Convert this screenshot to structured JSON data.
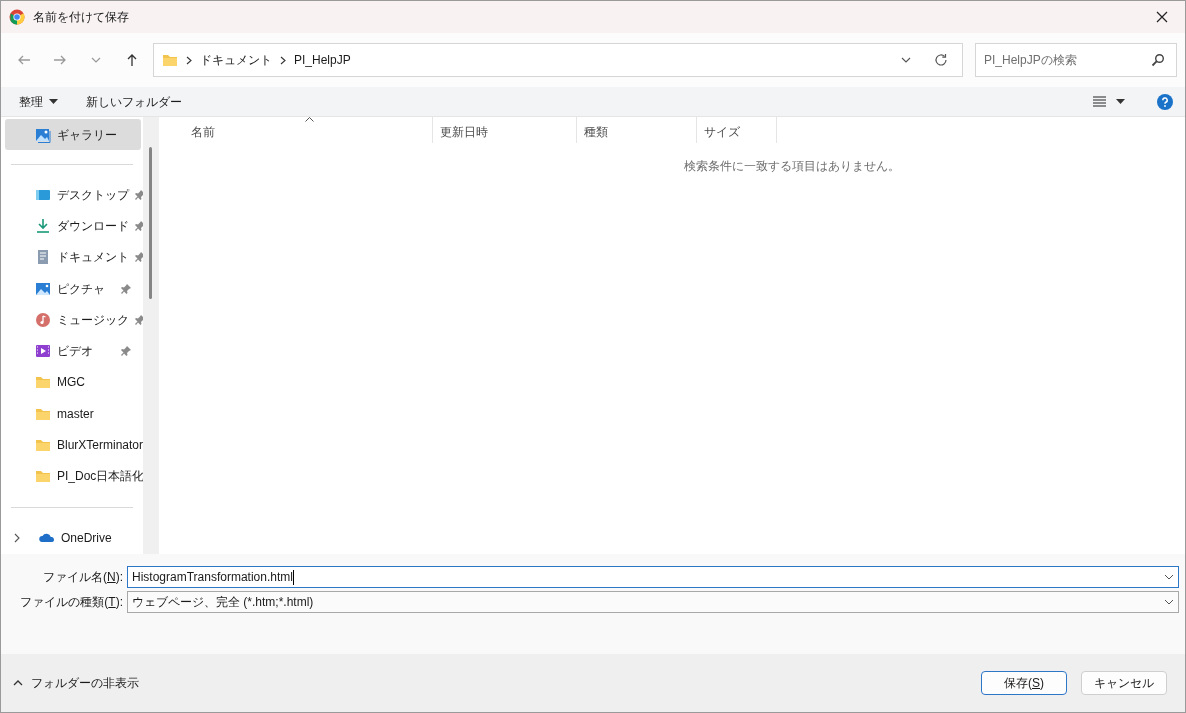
{
  "window": {
    "title": "名前を付けて保存"
  },
  "address": {
    "crumbs": [
      "ドキュメント",
      "PI_HelpJP"
    ]
  },
  "search": {
    "placeholder": "PI_HelpJPの検索"
  },
  "toolbar": {
    "organize": "整理",
    "new_folder": "新しいフォルダー"
  },
  "sidebar": {
    "items": [
      {
        "kind": "gallery",
        "label": "ギャラリー",
        "selected": true,
        "pinned": false
      },
      {
        "kind": "desktop",
        "label": "デスクトップ",
        "selected": false,
        "pinned": true
      },
      {
        "kind": "download",
        "label": "ダウンロード",
        "selected": false,
        "pinned": true
      },
      {
        "kind": "documents",
        "label": "ドキュメント",
        "selected": false,
        "pinned": true
      },
      {
        "kind": "pictures",
        "label": "ピクチャ",
        "selected": false,
        "pinned": true
      },
      {
        "kind": "music",
        "label": "ミュージック",
        "selected": false,
        "pinned": true
      },
      {
        "kind": "videos",
        "label": "ビデオ",
        "selected": false,
        "pinned": true
      },
      {
        "kind": "folder",
        "label": "MGC",
        "selected": false,
        "pinned": false
      },
      {
        "kind": "folder",
        "label": "master",
        "selected": false,
        "pinned": false
      },
      {
        "kind": "folder",
        "label": "BlurXTerminator",
        "selected": false,
        "pinned": false
      },
      {
        "kind": "folder",
        "label": "PI_Doc日本語化",
        "selected": false,
        "pinned": false
      },
      {
        "kind": "cloud",
        "label": "OneDrive",
        "selected": false,
        "pinned": false,
        "expanded": false
      }
    ]
  },
  "table": {
    "columns": [
      "名前",
      "更新日時",
      "種類",
      "サイズ"
    ],
    "empty_message": "検索条件に一致する項目はありません。"
  },
  "form": {
    "fields": [
      {
        "label": "ファイル名(",
        "access_key": "N",
        "label_end": "):",
        "value": "HistogramTransformation.html"
      },
      {
        "label": "ファイルの種類(",
        "access_key": "T",
        "label_end": "):",
        "value": "ウェブページ、完全 (*.htm;*.html)"
      }
    ]
  },
  "footer": {
    "hide_folders": "フォルダーの非表示",
    "buttons": [
      {
        "label": "保存(",
        "access_key": "S",
        "label_end": ")",
        "primary": true
      },
      {
        "label": "キャンセル",
        "primary": false
      }
    ]
  }
}
